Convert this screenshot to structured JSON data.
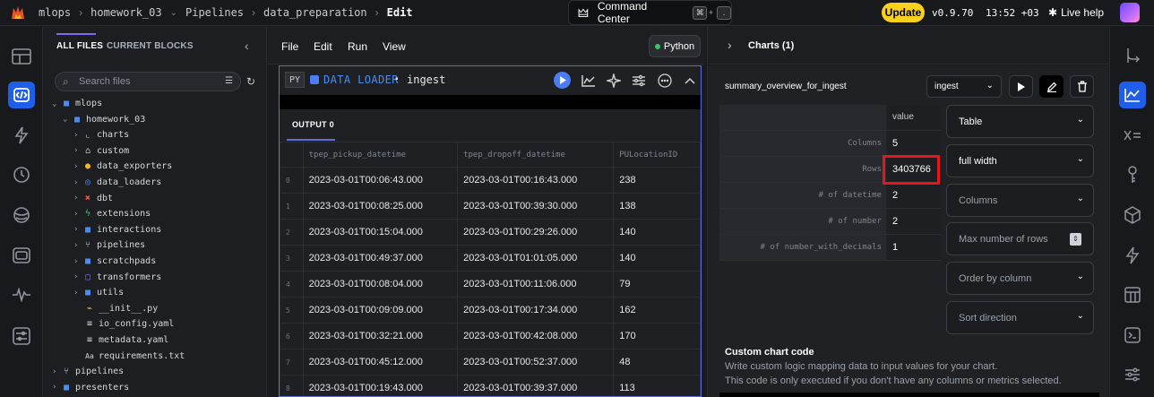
{
  "topbar": {
    "breadcrumbs": [
      "mlops",
      "homework_03",
      "Pipelines",
      "data_preparation",
      "Edit"
    ],
    "command_center": "Command Center",
    "shortcut_keys": [
      "⌘",
      "."
    ],
    "update_label": "Update",
    "version": "v0.9.70",
    "time": "13:52 +03",
    "live_help": "Live help"
  },
  "filepanel": {
    "tabs": [
      "ALL FILES",
      "CURRENT BLOCKS"
    ],
    "search_placeholder": "Search files",
    "tree": [
      {
        "label": "mlops",
        "icon": "folder-icon"
      },
      {
        "label": "homework_03",
        "icon": "folder-icon"
      },
      {
        "label": "charts",
        "icon": "chart-icon"
      },
      {
        "label": "custom",
        "icon": "custom-icon"
      },
      {
        "label": "data_exporters",
        "icon": "exporter-icon"
      },
      {
        "label": "data_loaders",
        "icon": "loader-icon"
      },
      {
        "label": "dbt",
        "icon": "dbt-icon"
      },
      {
        "label": "extensions",
        "icon": "extension-icon"
      },
      {
        "label": "interactions",
        "icon": "folder-icon"
      },
      {
        "label": "pipelines",
        "icon": "pipeline-icon"
      },
      {
        "label": "scratchpads",
        "icon": "folder-icon"
      },
      {
        "label": "transformers",
        "icon": "transformer-icon"
      },
      {
        "label": "utils",
        "icon": "folder-icon"
      },
      {
        "label": "__init__.py",
        "icon": "python-file-icon"
      },
      {
        "label": "io_config.yaml",
        "icon": "yaml-file-icon"
      },
      {
        "label": "metadata.yaml",
        "icon": "yaml-file-icon"
      },
      {
        "label": "requirements.txt",
        "icon": "text-file-icon"
      },
      {
        "label": "pipelines",
        "icon": "pipeline-icon"
      },
      {
        "label": "presenters",
        "icon": "folder-icon"
      }
    ]
  },
  "editor": {
    "menu": [
      "File",
      "Edit",
      "Run",
      "View"
    ],
    "language": "Python",
    "block": {
      "lang_tag": "PY",
      "type_label": "DATA LOADER",
      "name": "ingest"
    },
    "output_tab": "OUTPUT 0",
    "table": {
      "columns": [
        "tpep_pickup_datetime",
        "tpep_dropoff_datetime",
        "PULocationID"
      ],
      "rows": [
        [
          "0",
          "2023-03-01T00:06:43.000",
          "2023-03-01T00:16:43.000",
          "238"
        ],
        [
          "1",
          "2023-03-01T00:08:25.000",
          "2023-03-01T00:39:30.000",
          "138"
        ],
        [
          "2",
          "2023-03-01T00:15:04.000",
          "2023-03-01T00:29:26.000",
          "140"
        ],
        [
          "3",
          "2023-03-01T00:49:37.000",
          "2023-03-01T01:01:05.000",
          "140"
        ],
        [
          "4",
          "2023-03-01T00:08:04.000",
          "2023-03-01T00:11:06.000",
          "79"
        ],
        [
          "5",
          "2023-03-01T00:09:09.000",
          "2023-03-01T00:17:34.000",
          "162"
        ],
        [
          "6",
          "2023-03-01T00:32:21.000",
          "2023-03-01T00:42:08.000",
          "170"
        ],
        [
          "7",
          "2023-03-01T00:45:12.000",
          "2023-03-01T00:52:37.000",
          "48"
        ],
        [
          "8",
          "2023-03-01T00:19:43.000",
          "2023-03-01T00:39:37.000",
          "113"
        ]
      ]
    }
  },
  "charts": {
    "title": "Charts (1)",
    "chart_name": "summary_overview_for_ingest",
    "block_select": "ingest",
    "summary": {
      "value_header": "value",
      "rows": [
        {
          "label": "Columns",
          "value": "5"
        },
        {
          "label": "Rows",
          "value": "3403766"
        },
        {
          "label": "# of datetime",
          "value": "2"
        },
        {
          "label": "# of number",
          "value": "2"
        },
        {
          "label": "# of number_with_decimals",
          "value": "1"
        }
      ]
    },
    "options": [
      {
        "label": "Table"
      },
      {
        "label": "full width"
      },
      {
        "label": "Columns"
      },
      {
        "label": "Max number of rows"
      },
      {
        "label": "Order by column"
      },
      {
        "label": "Sort direction"
      }
    ],
    "custom_code_title": "Custom chart code",
    "custom_code_desc1": "Write custom logic mapping data to input values for your chart.",
    "custom_code_desc2": "This code is only executed if you don't have any columns or metrics selected.",
    "highlight_color": "#e8141e"
  },
  "colors": {
    "accent_blue": "#1f5ee8",
    "update_yellow": "#f9d01c"
  }
}
